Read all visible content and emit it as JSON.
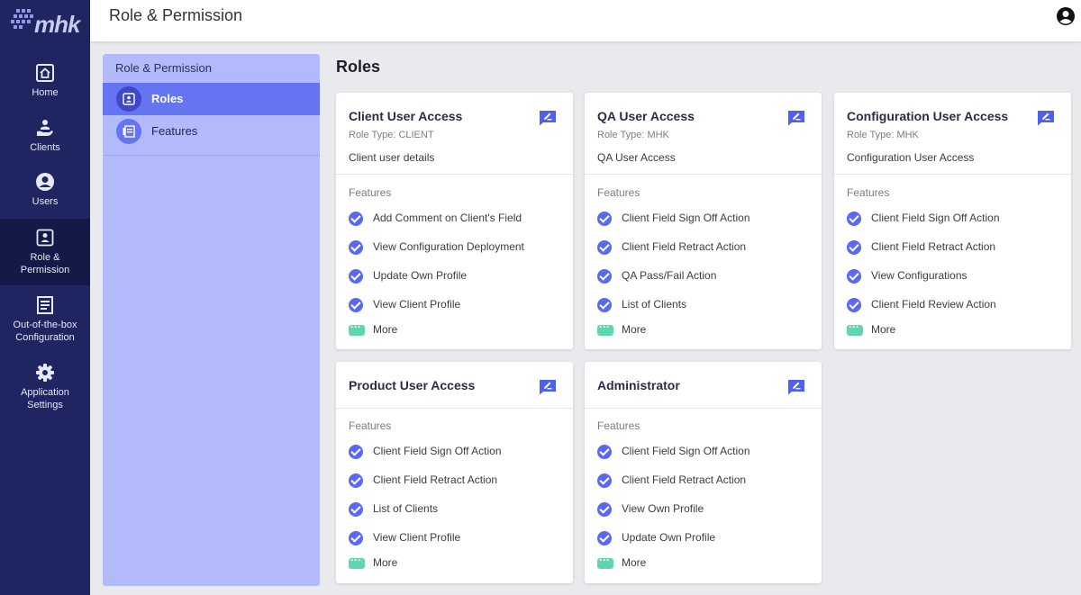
{
  "brand": {
    "logo_text": "mhk",
    "logo_icon": "mhk-dot-grid-logo"
  },
  "nav": {
    "items": [
      {
        "label": "Home",
        "icon": "home-icon"
      },
      {
        "label": "Clients",
        "icon": "clients-icon"
      },
      {
        "label": "Users",
        "icon": "users-icon"
      },
      {
        "label": "Role & Permission",
        "icon": "role-permission-icon",
        "active": true
      },
      {
        "label": "Out-of-the-box Configuration",
        "icon": "configuration-icon"
      },
      {
        "label": "Application Settings",
        "icon": "gear-icon"
      }
    ]
  },
  "header": {
    "title": "Role & Permission",
    "account_icon": "account-circle-icon"
  },
  "subnav": {
    "title": "Role & Permission",
    "items": [
      {
        "label": "Roles",
        "icon": "roles-icon",
        "active": true
      },
      {
        "label": "Features",
        "icon": "features-icon"
      }
    ]
  },
  "main": {
    "title": "Roles",
    "features_label": "Features",
    "more_label": "More",
    "cards": [
      {
        "name": "Client User Access",
        "type": "Role Type: CLIENT",
        "description": "Client user details",
        "features": [
          "Add Comment on Client's Field",
          "View Configuration Deployment",
          "Update Own Profile",
          "View Client Profile"
        ]
      },
      {
        "name": "QA User Access",
        "type": "Role Type: MHK",
        "description": "QA User Access",
        "features": [
          "Client Field Sign Off Action",
          "Client Field Retract Action",
          "QA Pass/Fail Action",
          "List of Clients"
        ]
      },
      {
        "name": "Configuration User Access",
        "type": "Role Type: MHK",
        "description": "Configuration User Access",
        "features": [
          "Client Field Sign Off Action",
          "Client Field Retract Action",
          "View Configurations",
          "Client Field Review Action"
        ]
      },
      {
        "name": "Product User Access",
        "features": [
          "Client Field Sign Off Action",
          "Client Field Retract Action",
          "List of Clients",
          "View Client Profile"
        ]
      },
      {
        "name": "Administrator",
        "features": [
          "Client Field Sign Off Action",
          "Client Field Retract Action",
          "View Own Profile",
          "Update Own Profile"
        ]
      }
    ]
  },
  "colors": {
    "nav_bg": "#1e2560",
    "accent": "#5a6af0",
    "subpanel_bg": "#b3bafc",
    "more_tag": "#5ed6b0"
  }
}
